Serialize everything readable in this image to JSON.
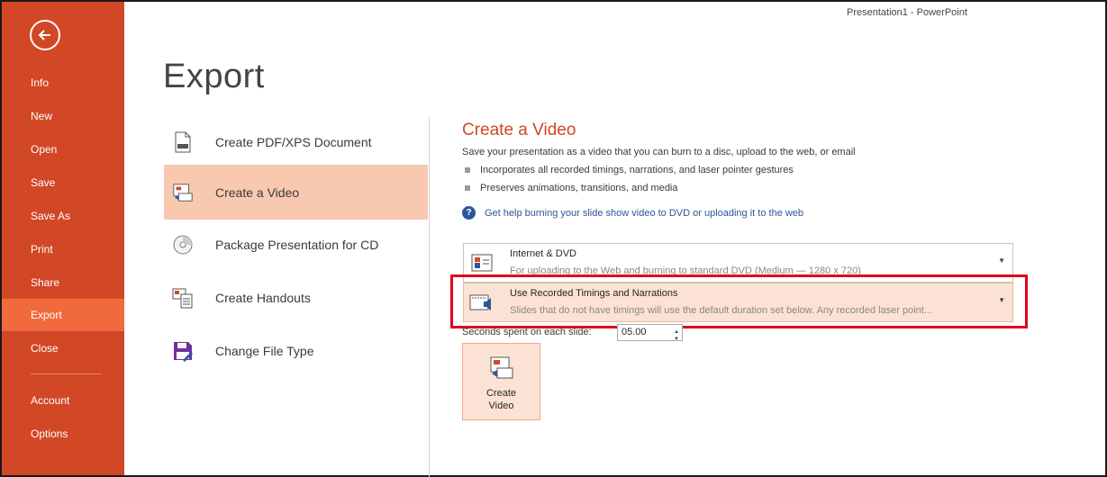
{
  "window": {
    "title": "Presentation1 - PowerPoint"
  },
  "nav": {
    "back_icon": "back-arrow-icon",
    "items": [
      {
        "label": "Info"
      },
      {
        "label": "New"
      },
      {
        "label": "Open"
      },
      {
        "label": "Save"
      },
      {
        "label": "Save As"
      },
      {
        "label": "Print"
      },
      {
        "label": "Share"
      },
      {
        "label": "Export",
        "active": true
      },
      {
        "label": "Close"
      },
      {
        "label": "Account"
      },
      {
        "label": "Options"
      }
    ]
  },
  "page": {
    "title": "Export"
  },
  "export_options": [
    {
      "label": "Create PDF/XPS Document",
      "icon": "pdf-document-icon"
    },
    {
      "label": "Create a Video",
      "icon": "video-icon",
      "selected": true
    },
    {
      "label": "Package Presentation for CD",
      "icon": "cd-icon"
    },
    {
      "label": "Create Handouts",
      "icon": "handouts-icon"
    },
    {
      "label": "Change File Type",
      "icon": "save-file-type-icon"
    }
  ],
  "video": {
    "title": "Create a Video",
    "description": "Save your presentation as a video that you can burn to a disc, upload to the web, or email",
    "bullets": [
      "Incorporates all recorded timings, narrations, and laser pointer gestures",
      "Preserves animations, transitions, and media"
    ],
    "help_link": "Get help burning your slide show video to DVD or uploading it to the web",
    "quality": {
      "title": "Internet & DVD",
      "subtitle": "For uploading to the Web and burning to standard DVD  (Medium — 1280 x 720)"
    },
    "timings": {
      "title": "Use Recorded Timings and Narrations",
      "subtitle": "Slides that do not have timings will use the default duration set below. Any recorded laser point..."
    },
    "seconds_label": "Seconds spent on each slide:",
    "seconds_value": "05.00",
    "create_button_line1": "Create",
    "create_button_line2": "Video"
  },
  "colors": {
    "backstage": "#d24726",
    "active_nav": "#f06a3d",
    "selected_option": "#f8c9b0",
    "accent_title": "#d24726",
    "link": "#2b579a",
    "highlight_box": "#e0001b"
  }
}
